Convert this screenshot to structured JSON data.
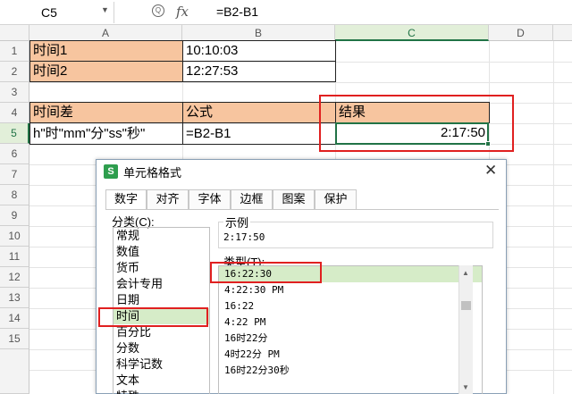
{
  "formula_bar": {
    "name_box": "C5",
    "fx_label": "fx",
    "formula": "=B2-B1"
  },
  "columns": [
    "A",
    "B",
    "C",
    "D"
  ],
  "rows": [
    "1",
    "2",
    "3",
    "4",
    "5",
    "6",
    "7",
    "8",
    "9",
    "10",
    "11",
    "12",
    "13",
    "14",
    "15"
  ],
  "cells": {
    "A1": "时间1",
    "B1": "10:10:03",
    "A2": "时间2",
    "B2": "12:27:53",
    "A4": "时间差",
    "B4": "公式",
    "C4": "结果",
    "A5": "h\"时\"mm\"分\"ss\"秒\"",
    "B5": "=B2-B1",
    "C5": "2:17:50"
  },
  "dialog": {
    "title": "单元格格式",
    "logo": "S",
    "close": "✕",
    "tabs": [
      "数字",
      "对齐",
      "字体",
      "边框",
      "图案",
      "保护"
    ],
    "category_label": "分类(C):",
    "categories": [
      "常规",
      "数值",
      "货币",
      "会计专用",
      "日期",
      "时间",
      "百分比",
      "分数",
      "科学记数",
      "文本",
      "特殊"
    ],
    "selected_category": "时间",
    "sample_label": "示例",
    "sample_value": "2:17:50",
    "type_label": "类型(T):",
    "types": [
      "16:22:30",
      "4:22:30 PM",
      "16:22",
      "4:22 PM",
      "16时22分",
      "4时22分 PM",
      "16时22分30秒"
    ],
    "selected_type": "16:22:30"
  },
  "colors": {
    "header_fill": "#f7c59f",
    "selection": "#217346",
    "highlight": "#e02020",
    "list_selection": "#d6ecc8"
  }
}
